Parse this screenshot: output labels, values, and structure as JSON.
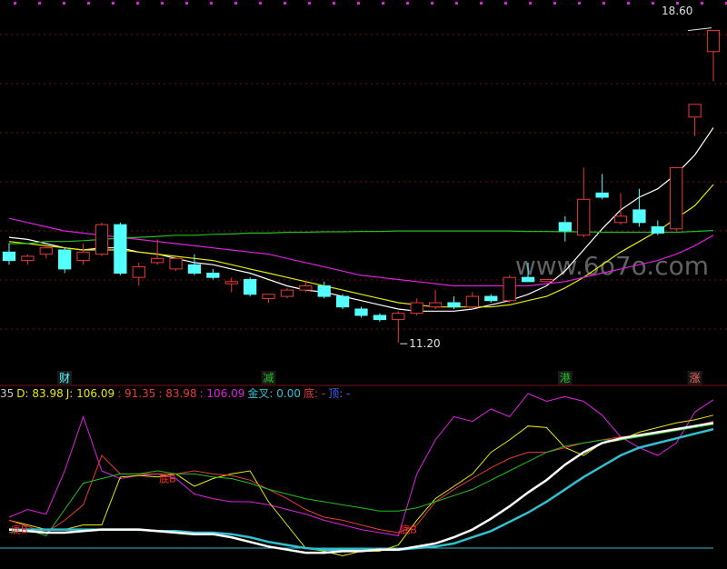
{
  "colors": {
    "bg": "#000000",
    "up": "#e83a3a",
    "down": "#54ffff",
    "ma1": "#ffffff",
    "ma2": "#e8e800",
    "ma3": "#e020e0",
    "ma4": "#20c020",
    "grid": "#7a1010",
    "k_line": "#ffffff",
    "d_line": "#30c0d0",
    "j_line": "#e8e800"
  },
  "watermark": "www.6o7o.com",
  "price_panel": {
    "max_label": "18.60",
    "min_label": "11.20",
    "event_labels": [
      {
        "index": 3,
        "text": "财",
        "color": "#54ffff"
      },
      {
        "index": 14,
        "text": "减",
        "color": "#20c020"
      },
      {
        "index": 30,
        "text": "港",
        "color": "#20c020"
      },
      {
        "index": 37,
        "text": "涨",
        "color": "#ff6060"
      }
    ]
  },
  "indicator_bar": [
    {
      "text": "35",
      "color": "#c8c8c8"
    },
    {
      "text": "D: 83.98",
      "color": "#e8e800"
    },
    {
      "text": "J: 106.09",
      "color": "#e8e800"
    },
    {
      "text": ": 91.35",
      "color": "#e83a3a"
    },
    {
      "text": ": 83.98",
      "color": "#e83a3a"
    },
    {
      "text": ": 106.09",
      "color": "#e020e0"
    },
    {
      "text": "金叉: 0.00",
      "color": "#30c0d0"
    },
    {
      "text": "底: -",
      "color": "#e83a3a"
    },
    {
      "text": "顶: -",
      "color": "#4060ff"
    }
  ],
  "indicator_labels": [
    {
      "text": "底B",
      "index": 8,
      "value": 55
    },
    {
      "text": "底B",
      "index": 21,
      "value": 22
    },
    {
      "text": "底B",
      "index": 0,
      "value": 22
    }
  ],
  "chart_data": {
    "type": "candlestick",
    "price_range": [
      10.6,
      19.0
    ],
    "candles": [
      {
        "o": 13.35,
        "h": 13.55,
        "l": 13.05,
        "c": 13.15
      },
      {
        "o": 13.15,
        "h": 13.3,
        "l": 13.05,
        "c": 13.25
      },
      {
        "o": 13.3,
        "h": 13.5,
        "l": 13.2,
        "c": 13.45
      },
      {
        "o": 13.4,
        "h": 13.45,
        "l": 12.85,
        "c": 12.95
      },
      {
        "o": 13.15,
        "h": 13.55,
        "l": 13.05,
        "c": 13.35
      },
      {
        "o": 13.3,
        "h": 14.05,
        "l": 13.25,
        "c": 14.0
      },
      {
        "o": 14.0,
        "h": 14.05,
        "l": 12.8,
        "c": 12.85
      },
      {
        "o": 12.75,
        "h": 13.1,
        "l": 12.55,
        "c": 13.0
      },
      {
        "o": 13.1,
        "h": 13.65,
        "l": 13.05,
        "c": 13.2
      },
      {
        "o": 12.95,
        "h": 13.2,
        "l": 12.9,
        "c": 13.2
      },
      {
        "o": 13.05,
        "h": 13.3,
        "l": 12.8,
        "c": 12.85
      },
      {
        "o": 12.85,
        "h": 12.95,
        "l": 12.7,
        "c": 12.75
      },
      {
        "o": 12.6,
        "h": 12.75,
        "l": 12.4,
        "c": 12.65
      },
      {
        "o": 12.7,
        "h": 12.75,
        "l": 12.3,
        "c": 12.35
      },
      {
        "o": 12.25,
        "h": 12.35,
        "l": 12.15,
        "c": 12.35
      },
      {
        "o": 12.3,
        "h": 12.5,
        "l": 12.25,
        "c": 12.45
      },
      {
        "o": 12.45,
        "h": 12.65,
        "l": 12.4,
        "c": 12.55
      },
      {
        "o": 12.55,
        "h": 12.65,
        "l": 12.25,
        "c": 12.3
      },
      {
        "o": 12.3,
        "h": 12.35,
        "l": 12.0,
        "c": 12.05
      },
      {
        "o": 12.0,
        "h": 12.05,
        "l": 11.8,
        "c": 11.85
      },
      {
        "o": 11.85,
        "h": 11.9,
        "l": 11.7,
        "c": 11.75
      },
      {
        "o": 11.75,
        "h": 11.95,
        "l": 11.2,
        "c": 11.9
      },
      {
        "o": 11.9,
        "h": 12.25,
        "l": 11.85,
        "c": 12.15
      },
      {
        "o": 12.05,
        "h": 12.45,
        "l": 12.0,
        "c": 12.15
      },
      {
        "o": 12.15,
        "h": 12.3,
        "l": 12.0,
        "c": 12.05
      },
      {
        "o": 12.05,
        "h": 12.4,
        "l": 12.0,
        "c": 12.3
      },
      {
        "o": 12.3,
        "h": 12.35,
        "l": 12.15,
        "c": 12.2
      },
      {
        "o": 12.2,
        "h": 12.8,
        "l": 12.15,
        "c": 12.75
      },
      {
        "o": 12.75,
        "h": 13.1,
        "l": 12.65,
        "c": 12.65
      },
      {
        "o": 12.65,
        "h": 12.7,
        "l": 12.65,
        "c": 12.7
      },
      {
        "o": 14.05,
        "h": 14.2,
        "l": 13.6,
        "c": 13.85
      },
      {
        "o": 13.75,
        "h": 15.35,
        "l": 13.7,
        "c": 14.6
      },
      {
        "o": 14.75,
        "h": 15.2,
        "l": 14.6,
        "c": 14.65
      },
      {
        "o": 14.05,
        "h": 14.75,
        "l": 14.0,
        "c": 14.2
      },
      {
        "o": 14.35,
        "h": 14.85,
        "l": 13.95,
        "c": 14.05
      },
      {
        "o": 13.95,
        "h": 14.1,
        "l": 13.75,
        "c": 13.8
      },
      {
        "o": 13.9,
        "h": 15.35,
        "l": 13.85,
        "c": 15.35
      },
      {
        "o": 16.55,
        "h": 16.85,
        "l": 16.1,
        "c": 16.85
      },
      {
        "o": 18.1,
        "h": 18.6,
        "l": 17.4,
        "c": 18.6
      }
    ],
    "ma_lines": [
      {
        "values": [
          13.7,
          13.65,
          13.55,
          13.45,
          13.4,
          13.45,
          13.45,
          13.35,
          13.3,
          13.2,
          13.1,
          13.05,
          12.95,
          12.85,
          12.7,
          12.55,
          12.45,
          12.4,
          12.3,
          12.2,
          12.1,
          12.0,
          11.95,
          11.95,
          11.95,
          12.0,
          12.1,
          12.2,
          12.35,
          12.55,
          12.9,
          13.4,
          13.9,
          14.35,
          14.65,
          14.85,
          15.2,
          15.65,
          16.3
        ]
      },
      {
        "values": [
          13.6,
          13.55,
          13.5,
          13.45,
          13.4,
          13.4,
          13.4,
          13.35,
          13.3,
          13.25,
          13.2,
          13.15,
          13.05,
          12.95,
          12.85,
          12.75,
          12.65,
          12.55,
          12.45,
          12.35,
          12.25,
          12.15,
          12.1,
          12.05,
          12.05,
          12.05,
          12.05,
          12.1,
          12.2,
          12.3,
          12.5,
          12.75,
          13.05,
          13.35,
          13.6,
          13.85,
          14.15,
          14.45,
          14.95
        ]
      },
      {
        "values": [
          14.15,
          14.05,
          13.95,
          13.85,
          13.8,
          13.75,
          13.7,
          13.65,
          13.6,
          13.55,
          13.5,
          13.45,
          13.4,
          13.35,
          13.3,
          13.2,
          13.1,
          13.0,
          12.9,
          12.8,
          12.75,
          12.7,
          12.65,
          12.6,
          12.55,
          12.55,
          12.55,
          12.55,
          12.55,
          12.6,
          12.65,
          12.75,
          12.85,
          12.95,
          13.05,
          13.15,
          13.3,
          13.5,
          13.75
        ]
      },
      {
        "values": [
          13.55,
          13.55,
          13.6,
          13.6,
          13.62,
          13.65,
          13.68,
          13.7,
          13.72,
          13.75,
          13.75,
          13.77,
          13.78,
          13.8,
          13.8,
          13.82,
          13.82,
          13.83,
          13.83,
          13.84,
          13.84,
          13.85,
          13.85,
          13.85,
          13.85,
          13.85,
          13.85,
          13.85,
          13.84,
          13.84,
          13.83,
          13.83,
          13.82,
          13.82,
          13.82,
          13.82,
          13.82,
          13.84,
          13.86
        ]
      }
    ],
    "kdj": {
      "range": [
        0,
        100
      ],
      "K": [
        22,
        21,
        20,
        20,
        21,
        22,
        22,
        22,
        21,
        20,
        19,
        19,
        17,
        14,
        11,
        9,
        7,
        7,
        8,
        8,
        9,
        9,
        11,
        13,
        17,
        22,
        29,
        37,
        46,
        54,
        64,
        72,
        78,
        81,
        83,
        85,
        87,
        89,
        91
      ],
      "D": [
        22,
        22,
        22,
        22,
        22,
        22,
        22,
        22,
        21,
        21,
        20,
        20,
        19,
        17,
        14,
        12,
        10,
        9,
        9,
        9,
        9,
        9,
        10,
        11,
        13,
        17,
        21,
        27,
        33,
        40,
        48,
        56,
        63,
        70,
        75,
        78,
        81,
        84,
        87
      ],
      "J": [
        28,
        25,
        22,
        22,
        25,
        25,
        56,
        57,
        56,
        58,
        50,
        55,
        58,
        60,
        40,
        25,
        10,
        8,
        5,
        8,
        8,
        12,
        28,
        42,
        50,
        58,
        72,
        80,
        89,
        88,
        75,
        70,
        78,
        80,
        85,
        88,
        91,
        93,
        96
      ],
      "line4": [
        28,
        24,
        20,
        28,
        38,
        70,
        58,
        58,
        58,
        58,
        60,
        58,
        57,
        54,
        48,
        42,
        35,
        30,
        28,
        25,
        22,
        20,
        25,
        40,
        48,
        55,
        62,
        68,
        72,
        72,
        75,
        78,
        80,
        82,
        83,
        85,
        87,
        89,
        92
      ],
      "line5": [
        20,
        22,
        18,
        35,
        52,
        55,
        58,
        58,
        60,
        58,
        58,
        56,
        55,
        52,
        48,
        45,
        42,
        40,
        38,
        36,
        34,
        34,
        36,
        40,
        44,
        48,
        54,
        60,
        66,
        72,
        76,
        78,
        80,
        80,
        82,
        84,
        86,
        88,
        90
      ],
      "line6": [
        30,
        35,
        32,
        60,
        95,
        60,
        55,
        57,
        58,
        55,
        45,
        42,
        40,
        40,
        38,
        35,
        32,
        28,
        25,
        22,
        20,
        18,
        58,
        80,
        95,
        92,
        100,
        95,
        110,
        105,
        108,
        105,
        96,
        82,
        75,
        70,
        78,
        98,
        106
      ]
    }
  }
}
